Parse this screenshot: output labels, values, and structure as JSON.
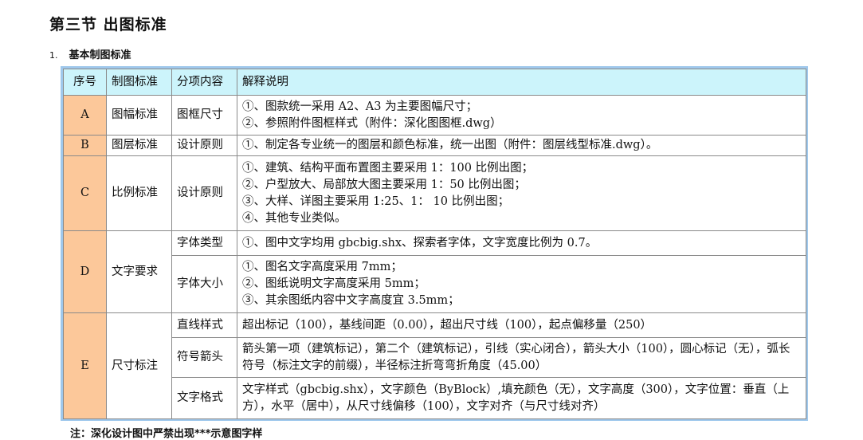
{
  "section_title": "第三节  出图标准",
  "subheading": {
    "number": "1.",
    "text": "基本制图标准"
  },
  "table": {
    "headers": [
      "序号",
      "制图标准",
      "分项内容",
      "解释说明"
    ],
    "rows": {
      "A": {
        "letter": "A",
        "standard": "图幅标准",
        "item": "图框尺寸",
        "lines": [
          "①、图款统一采用  A2、A3  为主要图幅尺寸；",
          "②、参照附件图框样式（附件：深化图图框.dwg）"
        ]
      },
      "B": {
        "letter": "B",
        "standard": "图层标准",
        "item": "设计原则",
        "lines": [
          "①、制定各专业统一的图层和颜色标准，统一出图（附件：图层线型标准.dwg）。"
        ]
      },
      "C": {
        "letter": "C",
        "standard": "比例标准",
        "item": "设计原则",
        "lines": [
          "①、建筑、结构平面布置图主要采用  1：100  比例出图；",
          "②、户型放大、局部放大图主要采用  1：50  比例出图；",
          "③、大样、详图主要采用  1:25、1：  10  比例出图；",
          "④、其他专业类似。"
        ]
      },
      "D": {
        "letter": "D",
        "standard": "文字要求",
        "sub1": {
          "item": "字体类型",
          "lines": [
            "①、图中文字均用  gbcbig.shx、探索者字体，文字宽度比例为  0.7。"
          ]
        },
        "sub2": {
          "item": "字体大小",
          "lines": [
            "①、图名文字高度采用  7mm；",
            "②、图纸说明文字高度采用  5mm；",
            "③、其余图纸内容中文字高度宜  3.5mm；"
          ]
        }
      },
      "E": {
        "letter": "E",
        "standard": "尺寸标注",
        "sub1": {
          "item": "直线样式",
          "text": "超出标记（100），基线间距（0.00），超出尺寸线（100），起点偏移量（250）"
        },
        "sub2": {
          "item": "符号箭头",
          "text": "箭头第一项（建筑标记），第二个（建筑标记），引线（实心闭合），箭头大小（100），圆心标记（无），弧长符号（标注文字的前缀），半径标注折弯弯折角度（45.00）"
        },
        "sub3": {
          "item": "文字格式",
          "text": "文字样式（gbcbig.shx），文字颜色（ByBlock）,填充颜色（无），文字高度（300），文字位置：垂直（上方），水平（居中），从尺寸线偏移（100），文字对齐（与尺寸线对齐）"
        }
      }
    }
  },
  "footer_note": "注：深化设计图中严禁出现***示意图字样",
  "colors": {
    "header_bg": "#ccf4fb",
    "letter_bg": "#fcc89a",
    "frame": "#9fc8ec"
  }
}
